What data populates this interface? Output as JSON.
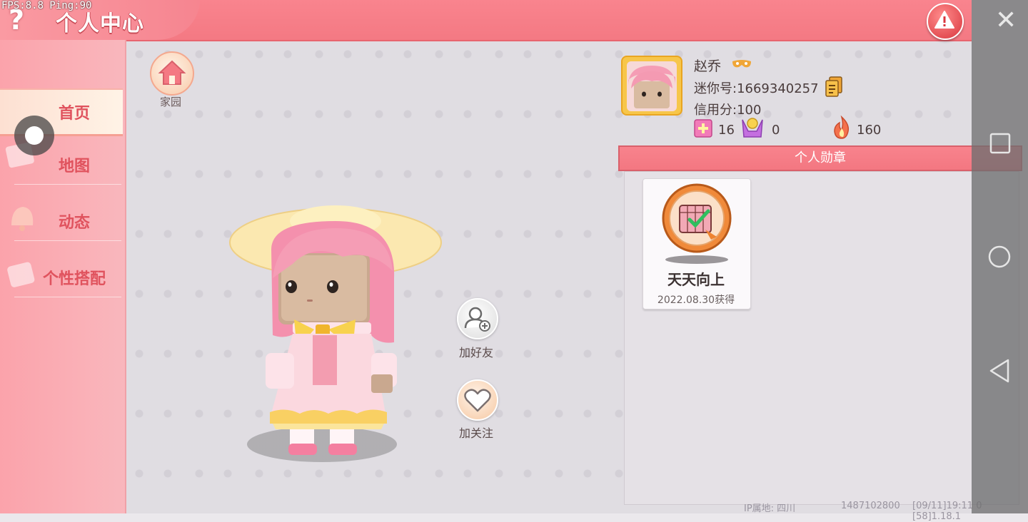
{
  "debug": {
    "fps_text": "FPS:8.8  Ping:90"
  },
  "header": {
    "title": "个人中心",
    "help_glyph": "?",
    "close_glyph": "✕"
  },
  "sidebar": {
    "items": [
      {
        "label": "首页",
        "active": true
      },
      {
        "label": "地图",
        "active": false
      },
      {
        "label": "动态",
        "active": false
      },
      {
        "label": "个性搭配",
        "active": false
      }
    ]
  },
  "home": {
    "label": "家园"
  },
  "actions": {
    "add_friend": "加好友",
    "follow": "加关注"
  },
  "profile": {
    "name": "赵乔",
    "mini_id": "迷你号:1669340257",
    "credit": "信用分:100",
    "stats": {
      "likes": "16",
      "fans": "0",
      "heat": "160"
    }
  },
  "medals": {
    "section_title": "个人勋章",
    "items": [
      {
        "name": "天天向上",
        "date": "2022.08.30获得"
      }
    ]
  },
  "footer": {
    "ip": "IP属地: 四川",
    "uid": "1487102800",
    "build": "[09/11]19:11 0  [58]1.18.1"
  },
  "colors": {
    "header": "#f47983",
    "sidebar": "#fba3ab",
    "accent_text": "#e0535e",
    "avatar_bg": "#f7c64a"
  }
}
